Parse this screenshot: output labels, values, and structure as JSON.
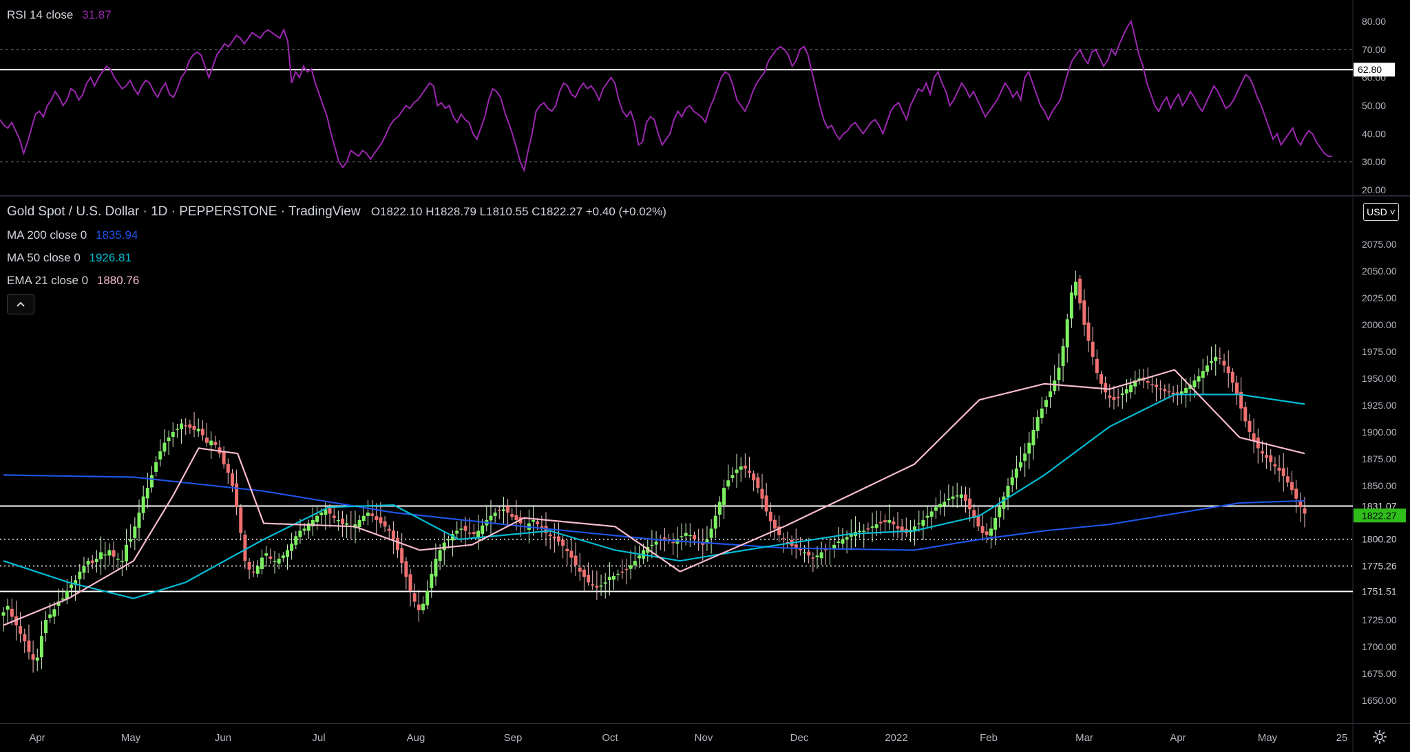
{
  "rsi_legend": {
    "label": "RSI 14 close",
    "value": "31.87",
    "color": "#9c27b0"
  },
  "main_legend": {
    "title": "Gold Spot / U.S. Dollar · 1D · PEPPERSTONE · TradingView",
    "ohlc": "O1822.10  H1828.79  L1810.55  C1822.27  +0.40 (+0.02%)",
    "indicators": [
      {
        "label": "MA 200 close 0",
        "value": "1835.94",
        "color": "#1e53e5"
      },
      {
        "label": "MA 50 close 0",
        "value": "1926.81",
        "color": "#00bcd4"
      },
      {
        "label": "EMA 21 close 0",
        "value": "1880.76",
        "color": "#f8bbd0"
      }
    ]
  },
  "currency_button": "USD",
  "collapse_icon": "chevron-up-icon",
  "settings_icon": "gear-icon",
  "chart_data": [
    {
      "type": "line",
      "panel": "rsi",
      "series": [
        {
          "name": "RSI 14 close",
          "color": "#9c27b0",
          "values": [
            45,
            43,
            42,
            44,
            41,
            38,
            33,
            37,
            42,
            47,
            48,
            46,
            50,
            52,
            55,
            53,
            50,
            52,
            56,
            55,
            52,
            54,
            58,
            60,
            57,
            60,
            62,
            64,
            63,
            60,
            58,
            56,
            57,
            59,
            56,
            54,
            57,
            59,
            58,
            55,
            53,
            56,
            58,
            54,
            53,
            56,
            60,
            62,
            66,
            68,
            69,
            68,
            64,
            60,
            64,
            68,
            70,
            72,
            71,
            73,
            75,
            74,
            72,
            74,
            76,
            75,
            74,
            76,
            77,
            76,
            75,
            74,
            77,
            73,
            58,
            62,
            60,
            64,
            62,
            63,
            58,
            54,
            50,
            46,
            40,
            35,
            30,
            28,
            30,
            34,
            33,
            32,
            34,
            33,
            31,
            33,
            35,
            37,
            40,
            43,
            45,
            46,
            48,
            50,
            49,
            51,
            52,
            54,
            56,
            58,
            57,
            50,
            51,
            49,
            50,
            46,
            44,
            47,
            45,
            44,
            40,
            38,
            42,
            46,
            52,
            56,
            55,
            53,
            48,
            44,
            40,
            35,
            30,
            27,
            34,
            40,
            48,
            50,
            51,
            49,
            48,
            50,
            55,
            58,
            57,
            54,
            53,
            56,
            58,
            56,
            57,
            55,
            52,
            56,
            58,
            60,
            58,
            52,
            48,
            46,
            48,
            44,
            36,
            37,
            44,
            46,
            45,
            40,
            36,
            38,
            40,
            45,
            48,
            46,
            49,
            50,
            48,
            47,
            46,
            44,
            49,
            52,
            56,
            60,
            62,
            61,
            57,
            52,
            50,
            48,
            51,
            55,
            58,
            60,
            62,
            66,
            68,
            70,
            71,
            70,
            68,
            64,
            66,
            70,
            71,
            68,
            62,
            56,
            50,
            45,
            42,
            43,
            40,
            38,
            40,
            41,
            43,
            44,
            42,
            40,
            42,
            44,
            45,
            43,
            40,
            44,
            48,
            50,
            51,
            48,
            45,
            50,
            53,
            56,
            55,
            58,
            54,
            60,
            62,
            58,
            55,
            50,
            52,
            55,
            58,
            56,
            53,
            55,
            52,
            49,
            46,
            48,
            50,
            52,
            55,
            58,
            56,
            53,
            55,
            52,
            60,
            62,
            58,
            54,
            50,
            48,
            45,
            48,
            50,
            52,
            57,
            62,
            66,
            68,
            70,
            67,
            65,
            69,
            70,
            67,
            64,
            66,
            70,
            68,
            72,
            75,
            78,
            80,
            74,
            68,
            64,
            58,
            54,
            50,
            48,
            51,
            53,
            49,
            52,
            54,
            50,
            52,
            55,
            53,
            50,
            48,
            51,
            54,
            57,
            55,
            52,
            49,
            50,
            52,
            55,
            58,
            61,
            60,
            57,
            53,
            50,
            46,
            42,
            38,
            40,
            36,
            38,
            40,
            42,
            38,
            36,
            39,
            41,
            40,
            37,
            35,
            33,
            32,
            31.87
          ]
        }
      ],
      "ylim": [
        20,
        82
      ],
      "y_ticks": [
        "80.00",
        "70.00",
        "60.00",
        "50.00",
        "40.00",
        "30.00",
        "20.00"
      ],
      "reference_lines": [
        70,
        30
      ],
      "level_line": {
        "value": 62.8,
        "label": "62.80"
      },
      "last_value": 31.87
    },
    {
      "type": "candlestick",
      "panel": "price",
      "x_labels": [
        "Apr",
        "May",
        "Jun",
        "Jul",
        "Aug",
        "Sep",
        "Oct",
        "Nov",
        "Dec",
        "2022",
        "Feb",
        "Mar",
        "Apr",
        "May",
        "25"
      ],
      "ylim": [
        1630,
        2085
      ],
      "y_ticks": [
        "2075.00",
        "2050.00",
        "2025.00",
        "2000.00",
        "1975.00",
        "1950.00",
        "1925.00",
        "1900.00",
        "1875.00",
        "1850.00",
        "1825.00",
        "1800.00",
        "1775.00",
        "1750.00",
        "1725.00",
        "1700.00",
        "1675.00",
        "1650.00"
      ],
      "anchor_closes": [
        1745,
        1725,
        1690,
        1735,
        1760,
        1795,
        1780,
        1840,
        1880,
        1905,
        1900,
        1885,
        1855,
        1780,
        1770,
        1790,
        1810,
        1825,
        1815,
        1810,
        1825,
        1812,
        1765,
        1790,
        1815,
        1820,
        1810,
        1800,
        1815,
        1755,
        1730,
        1770,
        1790,
        1800,
        1785,
        1795,
        1855,
        1865,
        1830,
        1790,
        1770,
        1795,
        1775,
        1790,
        1800,
        1800,
        1820,
        1805,
        1815,
        1835,
        1855,
        1820,
        1800,
        1835,
        1870,
        1910,
        1950,
        1920,
        2040,
        1970,
        1930,
        1940,
        1925,
        1935,
        1955,
        1975,
        1940,
        1905,
        1880,
        1860,
        1850,
        1824
      ],
      "close_series": [
        1732,
        1738,
        1728,
        1720,
        1712,
        1705,
        1695,
        1688,
        1690,
        1710,
        1725,
        1730,
        1735,
        1742,
        1745,
        1752,
        1758,
        1762,
        1770,
        1775,
        1780,
        1778,
        1782,
        1788,
        1786,
        1790,
        1784,
        1782,
        1780,
        1795,
        1800,
        1812,
        1825,
        1840,
        1848,
        1860,
        1872,
        1882,
        1890,
        1895,
        1900,
        1903,
        1908,
        1906,
        1904,
        1902,
        1903,
        1897,
        1890,
        1892,
        1888,
        1880,
        1870,
        1862,
        1850,
        1830,
        1806,
        1780,
        1772,
        1770,
        1775,
        1783,
        1787,
        1782,
        1780,
        1782,
        1785,
        1790,
        1796,
        1803,
        1808,
        1810,
        1815,
        1818,
        1822,
        1825,
        1828,
        1824,
        1820,
        1818,
        1814,
        1815,
        1812,
        1814,
        1818,
        1822,
        1825,
        1822,
        1818,
        1815,
        1812,
        1808,
        1800,
        1790,
        1778,
        1765,
        1752,
        1742,
        1734,
        1740,
        1752,
        1768,
        1782,
        1790,
        1797,
        1800,
        1805,
        1808,
        1810,
        1808,
        1806,
        1805,
        1808,
        1813,
        1818,
        1822,
        1825,
        1827,
        1828,
        1825,
        1821,
        1818,
        1815,
        1812,
        1815,
        1818,
        1814,
        1810,
        1806,
        1803,
        1801,
        1798,
        1794,
        1789,
        1783,
        1776,
        1770,
        1765,
        1760,
        1757,
        1755,
        1757,
        1760,
        1765,
        1766,
        1768,
        1770,
        1772,
        1776,
        1780,
        1785,
        1790,
        1793,
        1795,
        1798,
        1799,
        1800,
        1799,
        1797,
        1800,
        1803,
        1806,
        1804,
        1800,
        1797,
        1795,
        1800,
        1810,
        1822,
        1835,
        1848,
        1855,
        1860,
        1865,
        1868,
        1866,
        1862,
        1855,
        1848,
        1838,
        1826,
        1817,
        1810,
        1804,
        1800,
        1797,
        1794,
        1792,
        1790,
        1788,
        1785,
        1783,
        1785,
        1788,
        1790,
        1792,
        1795,
        1798,
        1800,
        1802,
        1805,
        1807,
        1808,
        1808,
        1810,
        1812,
        1814,
        1815,
        1816,
        1818,
        1814,
        1810,
        1808,
        1806,
        1809,
        1812,
        1815,
        1818,
        1822,
        1826,
        1830,
        1833,
        1835,
        1838,
        1840,
        1841,
        1842,
        1836,
        1828,
        1820,
        1812,
        1806,
        1804,
        1810,
        1820,
        1830,
        1840,
        1850,
        1858,
        1866,
        1872,
        1880,
        1890,
        1902,
        1914,
        1922,
        1930,
        1938,
        1948,
        1960,
        1980,
        2005,
        2030,
        2040,
        2020,
        2000,
        1985,
        1970,
        1955,
        1945,
        1937,
        1932,
        1930,
        1932,
        1936,
        1940,
        1944,
        1948,
        1950,
        1948,
        1946,
        1944,
        1942,
        1940,
        1938,
        1937,
        1935,
        1936,
        1938,
        1941,
        1944,
        1948,
        1952,
        1957,
        1962,
        1966,
        1970,
        1968,
        1962,
        1955,
        1946,
        1935,
        1922,
        1910,
        1900,
        1892,
        1885,
        1880,
        1876,
        1872,
        1868,
        1864,
        1859,
        1853,
        1846,
        1838,
        1830,
        1824
      ],
      "reference_lines": [
        {
          "value": 1831.07,
          "label": "1831.07",
          "style": "solid"
        },
        {
          "value": 1800.2,
          "label": "1800.20",
          "style": "dotted"
        },
        {
          "value": 1775.26,
          "label": "1775.26",
          "style": "dotted"
        },
        {
          "value": 1751.51,
          "label": "1751.51",
          "style": "solid"
        }
      ],
      "last_price": {
        "value": 1822.27,
        "label": "1822.27",
        "color": "#2ebd1a"
      },
      "ma_series": [
        {
          "name": "MA 200 close 0",
          "color": "#1e53e5",
          "points": [
            [
              0,
              1860
            ],
            [
              0.1,
              1858
            ],
            [
              0.2,
              1845
            ],
            [
              0.3,
              1825
            ],
            [
              0.4,
              1812
            ],
            [
              0.5,
              1800
            ],
            [
              0.6,
              1792
            ],
            [
              0.7,
              1790
            ],
            [
              0.75,
              1800
            ],
            [
              0.8,
              1808
            ],
            [
              0.85,
              1814
            ],
            [
              0.9,
              1824
            ],
            [
              0.95,
              1834
            ],
            [
              1.0,
              1836
            ]
          ]
        },
        {
          "name": "MA 50 close 0",
          "color": "#00bcd4",
          "points": [
            [
              0,
              1780
            ],
            [
              0.05,
              1760
            ],
            [
              0.1,
              1745
            ],
            [
              0.14,
              1760
            ],
            [
              0.2,
              1800
            ],
            [
              0.25,
              1830
            ],
            [
              0.3,
              1832
            ],
            [
              0.35,
              1800
            ],
            [
              0.42,
              1808
            ],
            [
              0.47,
              1790
            ],
            [
              0.52,
              1780
            ],
            [
              0.58,
              1792
            ],
            [
              0.65,
              1805
            ],
            [
              0.7,
              1808
            ],
            [
              0.75,
              1822
            ],
            [
              0.8,
              1860
            ],
            [
              0.85,
              1905
            ],
            [
              0.9,
              1935
            ],
            [
              0.95,
              1935
            ],
            [
              1.0,
              1926
            ]
          ]
        },
        {
          "name": "EMA 21 close 0",
          "color": "#f8bbd0",
          "points": [
            [
              0,
              1720
            ],
            [
              0.05,
              1745
            ],
            [
              0.1,
              1780
            ],
            [
              0.13,
              1840
            ],
            [
              0.15,
              1885
            ],
            [
              0.18,
              1880
            ],
            [
              0.2,
              1815
            ],
            [
              0.27,
              1812
            ],
            [
              0.32,
              1790
            ],
            [
              0.36,
              1795
            ],
            [
              0.4,
              1820
            ],
            [
              0.47,
              1812
            ],
            [
              0.52,
              1770
            ],
            [
              0.6,
              1812
            ],
            [
              0.7,
              1870
            ],
            [
              0.75,
              1930
            ],
            [
              0.8,
              1945
            ],
            [
              0.85,
              1940
            ],
            [
              0.9,
              1958
            ],
            [
              0.95,
              1895
            ],
            [
              1.0,
              1880
            ]
          ]
        }
      ]
    }
  ]
}
